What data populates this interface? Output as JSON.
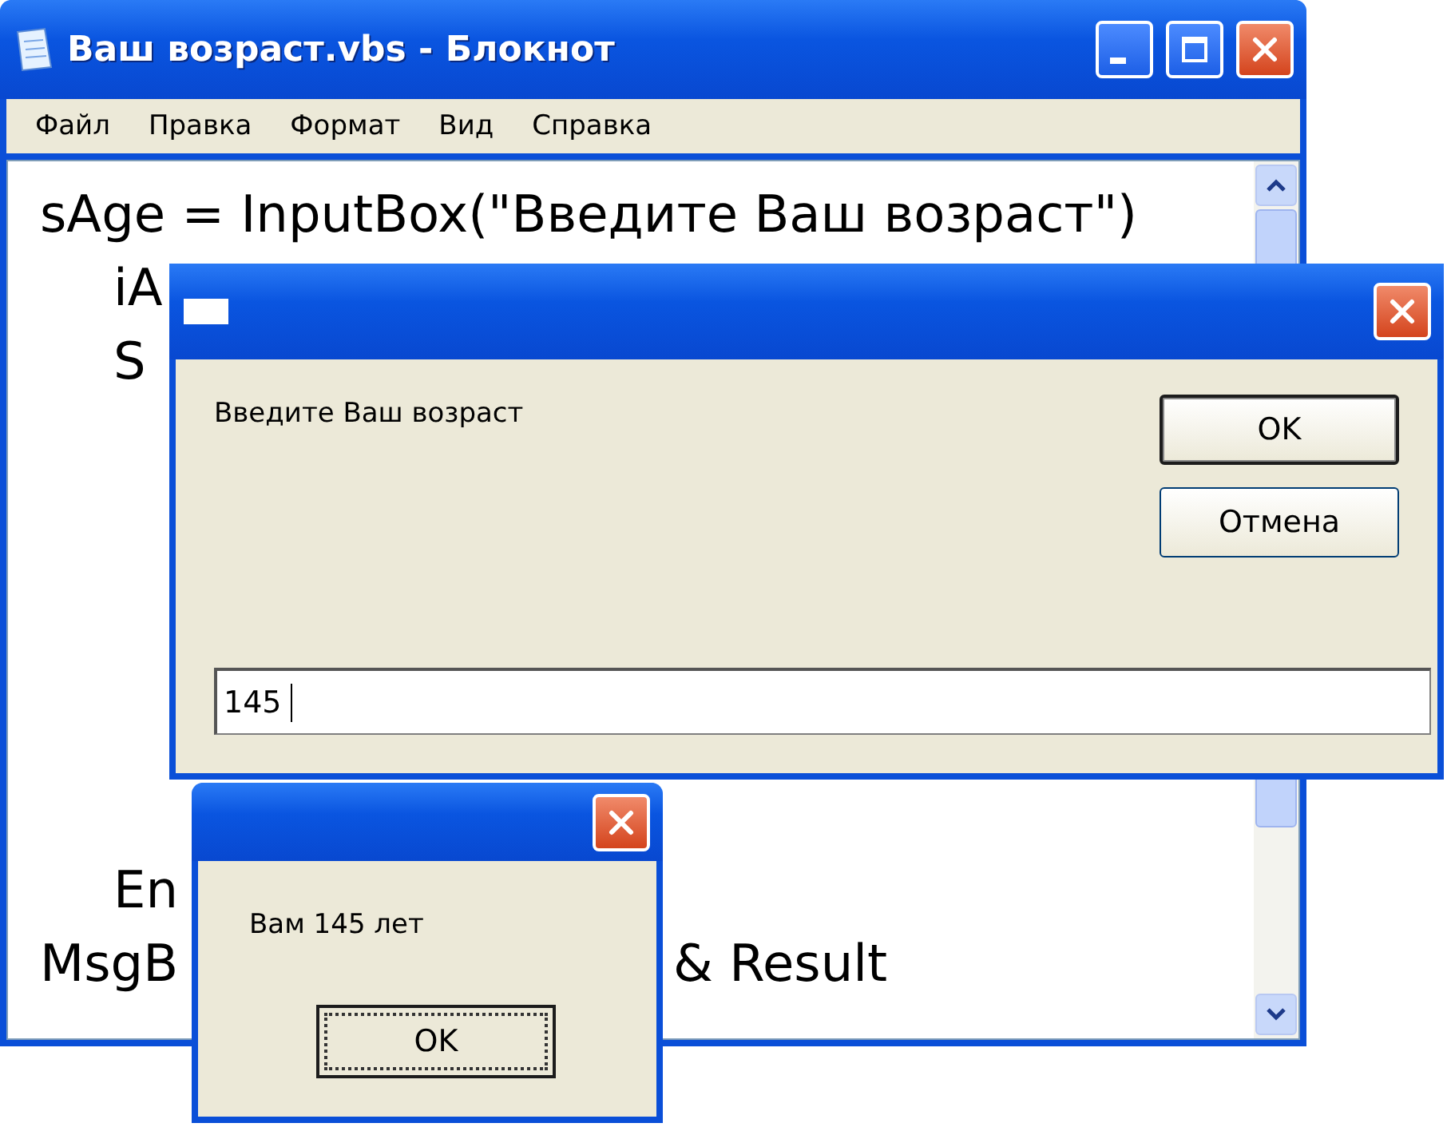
{
  "notepad": {
    "title": "Ваш возраст.vbs - Блокнот",
    "menu": [
      {
        "label": "Файл"
      },
      {
        "label": "Правка"
      },
      {
        "label": "Формат"
      },
      {
        "label": "Вид"
      },
      {
        "label": "Справка"
      }
    ],
    "code_top": [
      {
        "text": "sAge = InputBox(\"Введите Ваш возраст\")",
        "indented": false
      },
      {
        "text": "iA",
        "indented": true
      },
      {
        "text": "S",
        "indented": true
      }
    ],
    "code_bottom": [
      {
        "text": "En",
        "indented": true
      },
      {
        "text": "MsgB",
        "indented": false,
        "tail": "& Result"
      }
    ]
  },
  "input_dialog": {
    "prompt": "Введите Ваш возраст",
    "buttons": [
      {
        "label": "OK",
        "default": true
      },
      {
        "label": "Отмена",
        "default": false
      }
    ],
    "input": {
      "value": "145"
    }
  },
  "message_box": {
    "message": "Вам 145 лет",
    "button": {
      "label": "OK",
      "focused": true
    }
  }
}
